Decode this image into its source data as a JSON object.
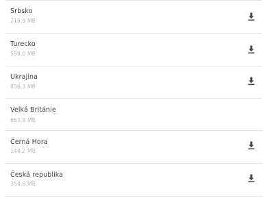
{
  "maps": [
    {
      "name": "Srbsko",
      "size": "219,9 MB",
      "downloadable": true,
      "icon": "download-icon"
    },
    {
      "name": "Turecko",
      "size": "598,0 MB",
      "downloadable": true,
      "icon": "download-icon"
    },
    {
      "name": "Ukrajina",
      "size": "836,3 MB",
      "downloadable": true,
      "icon": "download-icon"
    },
    {
      "name": "Velká Británie",
      "size": "663,8 MB",
      "downloadable": false
    },
    {
      "name": "Černá Hora",
      "size": "144,2 MB",
      "downloadable": true,
      "icon": "download-icon"
    },
    {
      "name": "Česká republika",
      "size": "354,8 MB",
      "downloadable": true,
      "icon": "download-icon"
    }
  ],
  "colors": {
    "text": "#3c3c3c",
    "subtext": "#b3b3b3",
    "icon": "#444444",
    "divider": "#e2e2e2",
    "background": "#ffffff"
  }
}
